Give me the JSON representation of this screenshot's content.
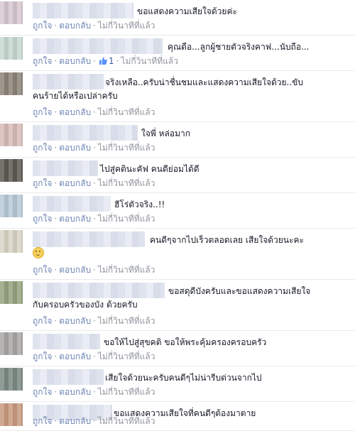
{
  "actions": {
    "like_label": "ถูกใจ",
    "reply_label": "ตอบกลับ",
    "separator": "·",
    "time_label": "ไม่กี่วินาทีที่แล้ว"
  },
  "comments": [
    {
      "text": "ขอแสดงความเสียใจด้วยค่ะ",
      "avatar_color": "#d7c8cf"
    },
    {
      "text": "คุณดือ...ลูกผู้ชายตัวจริงคาฟ...นับถือ...",
      "avatar_color": "#c6d8d0",
      "likes": "1"
    },
    {
      "text": "จริงเหลือ..ครับน่าชื่นชมและแสดงความเสียใจด้วย..ขับ",
      "text2": "คนร้ายได้หรือเปล่าครับ",
      "avatar_color": "#8c8478"
    },
    {
      "text": "ใจพี่ หล่อมาก",
      "avatar_color": "#d7bcb8"
    },
    {
      "text": "ไปสู่คตินะคัฟ คนดีย่อมได้ดี",
      "avatar_color": "#5e5a52"
    },
    {
      "text": "ฮีโร่ตัวจริง..!!",
      "avatar_color": "#b7c9d6"
    },
    {
      "text": "คนดีๆจากไปเร็วตลอดเลย เสียใจด้วยนะคะ",
      "text2_emoji": true,
      "avatar_color": "#d9d4c4"
    },
    {
      "text": "ขอสดุดีบังครับและขอแสดงความเสียใจ",
      "text2": "กับครอบครัวของบัง ด้วยครับ",
      "avatar_color": "#95a37f"
    },
    {
      "text": "ขอให้ไปสู่สุขคติ ขอให้พระคุ้มครองครอบครัว",
      "avatar_color": "#a8a7a5"
    },
    {
      "text": "เสียใจด้วยนะครับคนดีๆไม่น่ารีบด่วนจากไป",
      "avatar_color": "#7c8a84"
    },
    {
      "text": "ขอแสดงความเสียใจที่คนดีๆต้องมาตาย",
      "avatar_color": "#c89a80"
    }
  ],
  "colors": {
    "link": "#6d84b4",
    "meta": "#90949c",
    "text": "#141823"
  }
}
